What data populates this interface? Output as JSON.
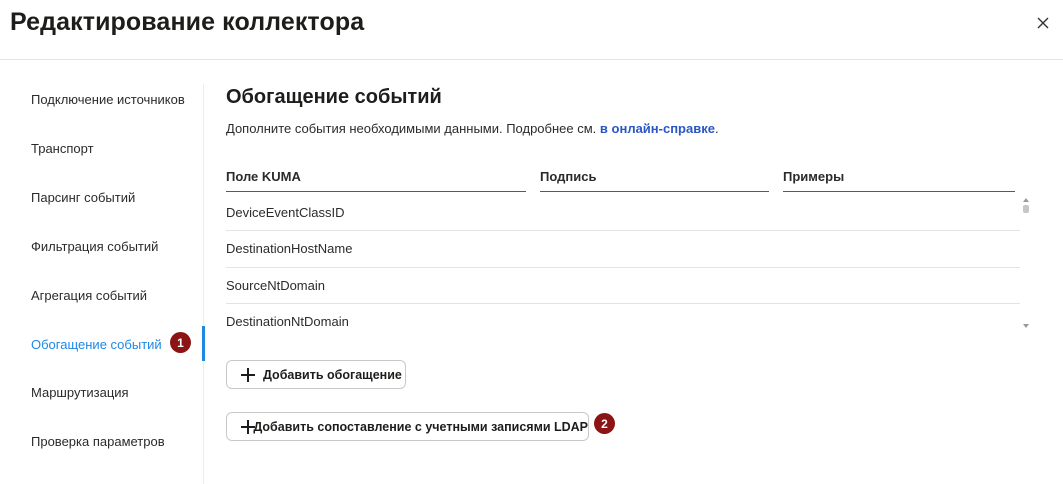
{
  "dialog": {
    "title": "Редактирование коллектора",
    "close_icon": "close-icon"
  },
  "sidebar": {
    "items": [
      {
        "label": "Подключение источников",
        "active": false
      },
      {
        "label": "Транспорт",
        "active": false
      },
      {
        "label": "Парсинг событий",
        "active": false
      },
      {
        "label": "Фильтрация событий",
        "active": false
      },
      {
        "label": "Агрегация событий",
        "active": false
      },
      {
        "label": "Обогащение событий",
        "active": true
      },
      {
        "label": "Маршрутизация",
        "active": false
      },
      {
        "label": "Проверка параметров",
        "active": false
      }
    ],
    "active_badge": "1"
  },
  "section": {
    "title": "Обогащение событий",
    "description": "Дополните события необходимыми данными. Подробнее см.",
    "link_text": "в онлайн-справке",
    "after_link": "."
  },
  "table": {
    "columns": [
      "Поле KUMA",
      "Подпись",
      "Примеры"
    ],
    "rows": [
      "DeviceEventClassID",
      "DestinationHostName",
      "SourceNtDomain",
      "DestinationNtDomain"
    ]
  },
  "buttons": {
    "add_enrichment": "Добавить обогащение",
    "add_ldap_mapping": "Добавить сопоставление с учетными записями LDAP",
    "ldap_badge": "2"
  },
  "colors": {
    "accent": "#1e88e5",
    "link": "#2a56c6",
    "badge": "#8b1414"
  }
}
